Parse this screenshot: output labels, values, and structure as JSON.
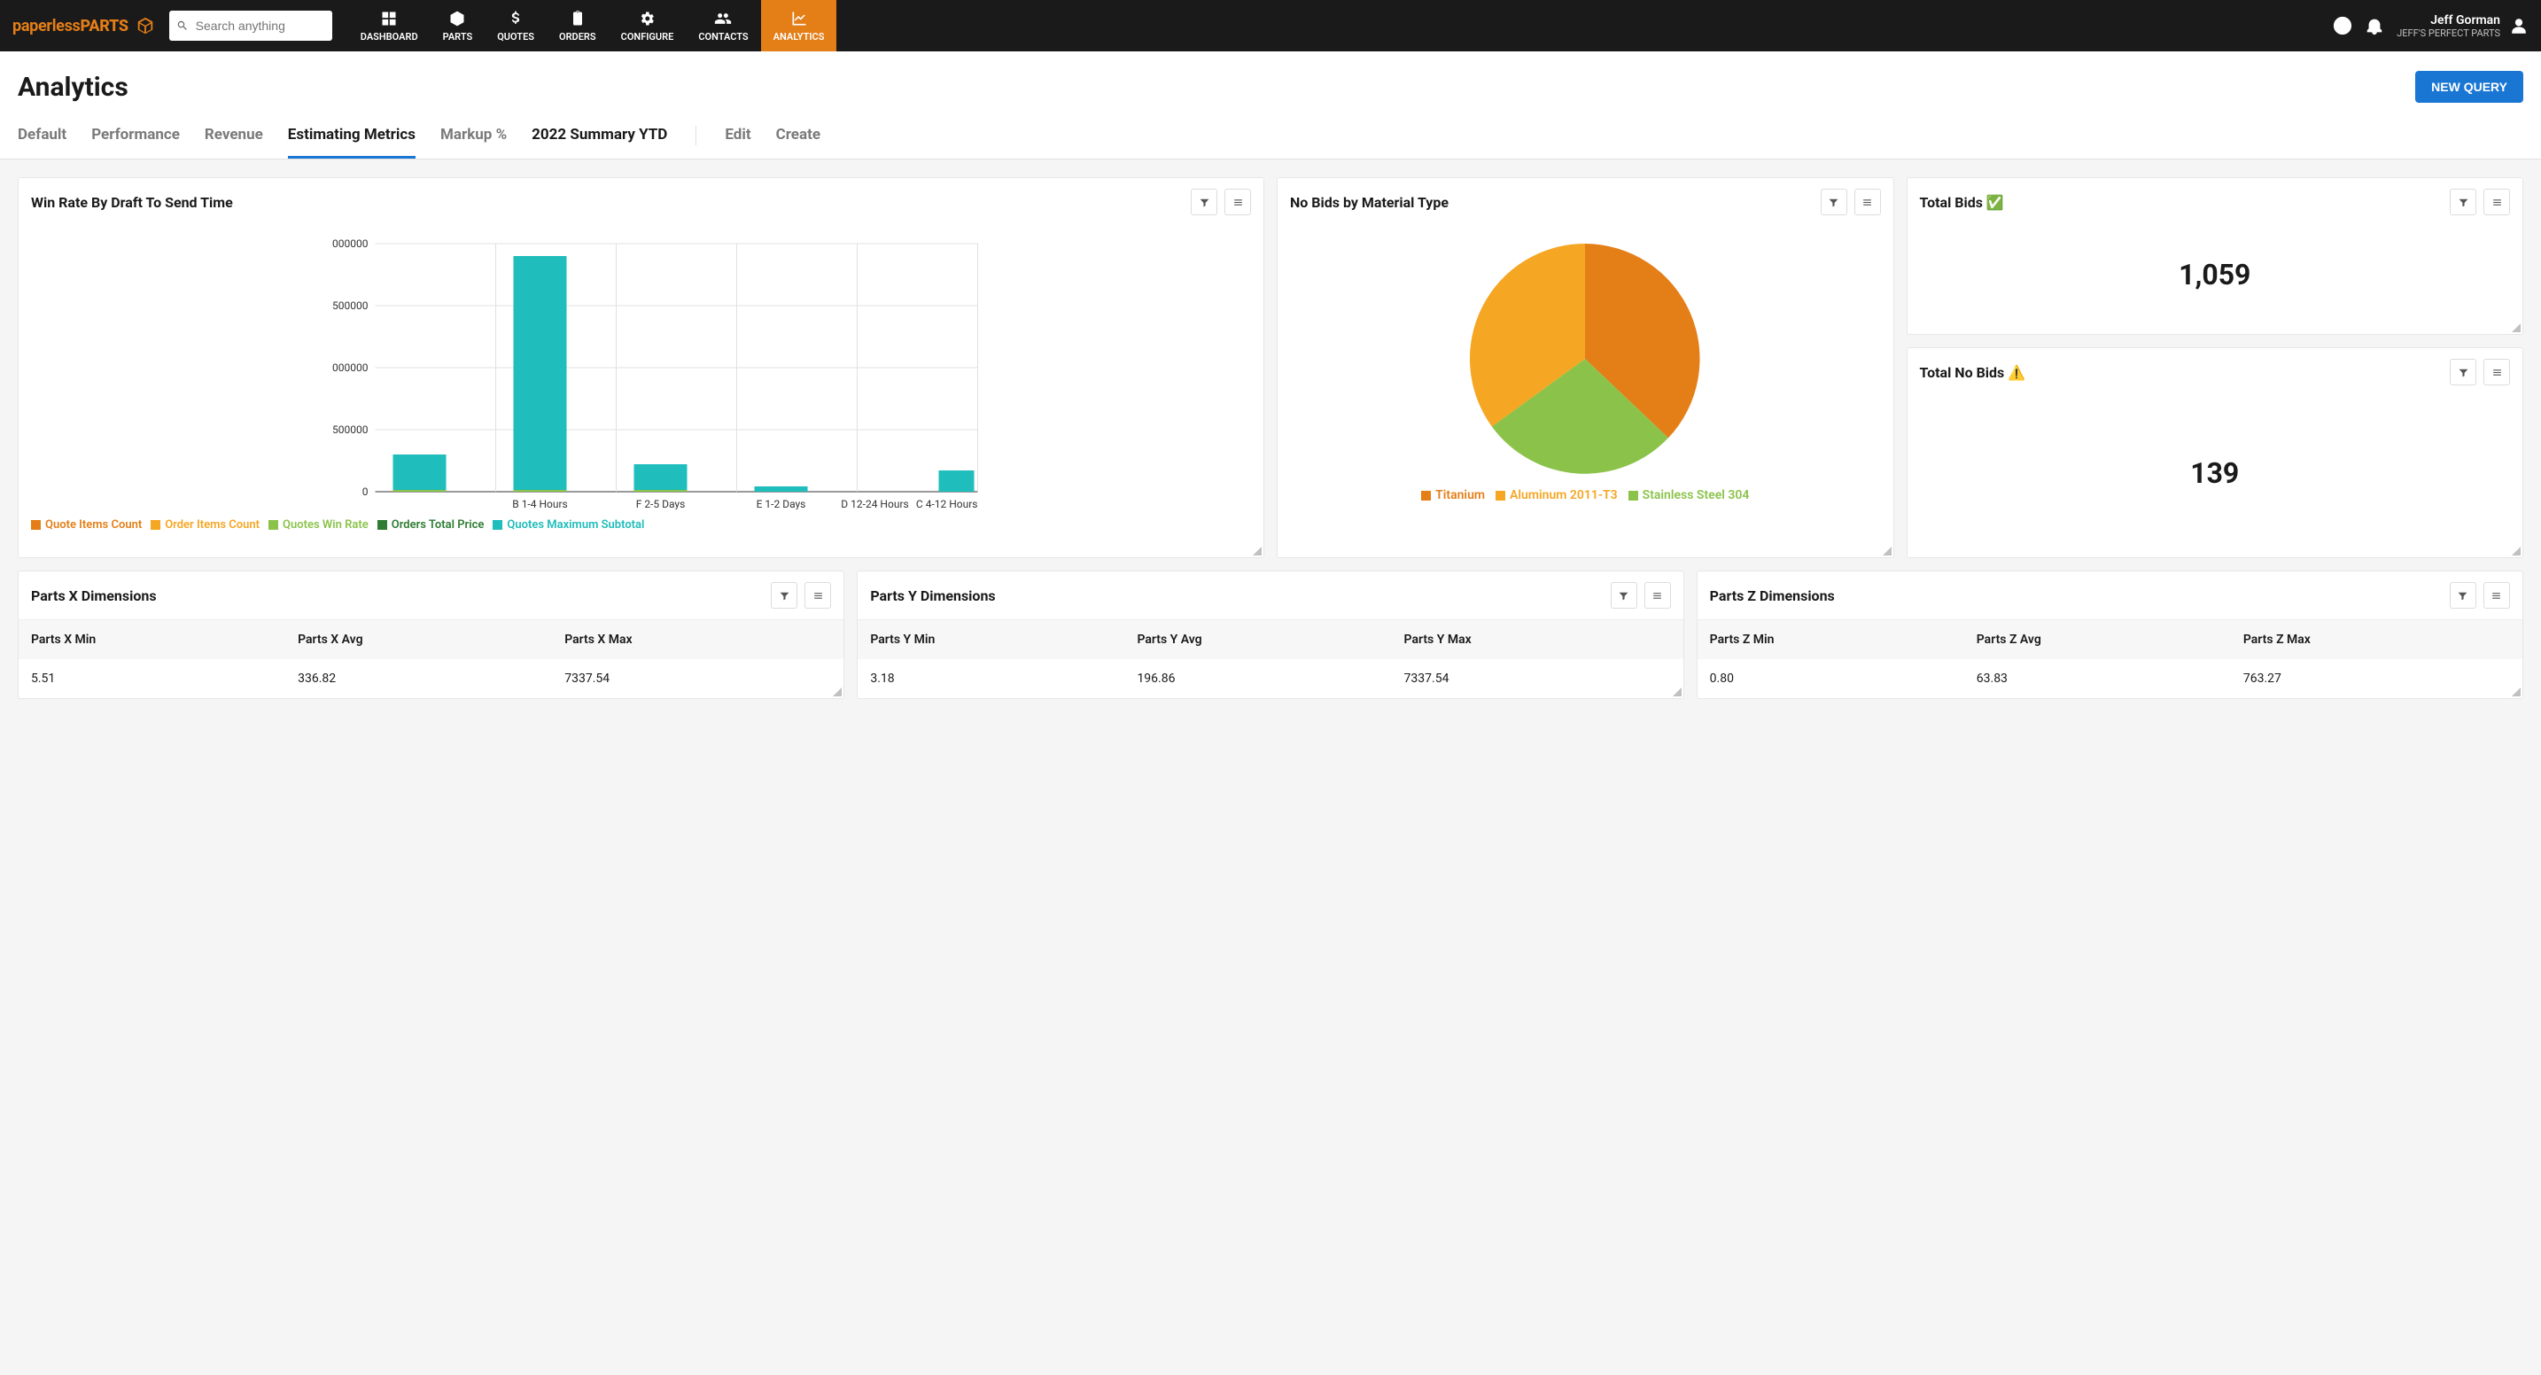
{
  "header": {
    "logo_p1": "paperless",
    "logo_p2": "PARTS",
    "search_placeholder": "Search anything",
    "nav": [
      {
        "label": "DASHBOARD"
      },
      {
        "label": "PARTS"
      },
      {
        "label": "QUOTES"
      },
      {
        "label": "ORDERS"
      },
      {
        "label": "CONFIGURE"
      },
      {
        "label": "CONTACTS"
      },
      {
        "label": "ANALYTICS"
      }
    ],
    "user_name": "Jeff Gorman",
    "user_company": "JEFF'S PERFECT PARTS"
  },
  "page": {
    "title": "Analytics",
    "new_query": "NEW QUERY",
    "tabs": [
      "Default",
      "Performance",
      "Revenue",
      "Estimating Metrics",
      "Markup %",
      "2022 Summary YTD"
    ],
    "tab_edit": "Edit",
    "tab_create": "Create"
  },
  "cards": {
    "win_rate": {
      "title": "Win Rate By Draft To Send Time",
      "legend": [
        {
          "label": "Quote Items Count",
          "color": "#e47e17"
        },
        {
          "label": "Order Items Count",
          "color": "#f0aone"
        },
        {
          "label": "Quotes Win Rate",
          "color": "#8bc34a"
        },
        {
          "label": "Orders Total Price",
          "color": "#2e7d32"
        },
        {
          "label": "Quotes Maximum Subtotal",
          "color": "#1fbdbb"
        }
      ]
    },
    "no_bids": {
      "title": "No Bids by Material Type",
      "legend": [
        {
          "label": "Titanium",
          "color": "#e47e17"
        },
        {
          "label": "Aluminum 2011-T3",
          "color": "#f5a623"
        },
        {
          "label": "Stainless Steel 304",
          "color": "#8bc34a"
        }
      ]
    },
    "total_bids": {
      "title": "Total Bids ✅",
      "value": "1,059"
    },
    "total_no_bids": {
      "title": "Total No Bids ⚠️",
      "value": "139"
    },
    "parts_x": {
      "title": "Parts X Dimensions",
      "h1": "Parts X Min",
      "h2": "Parts X Avg",
      "h3": "Parts X Max",
      "v1": "5.51",
      "v2": "336.82",
      "v3": "7337.54"
    },
    "parts_y": {
      "title": "Parts Y Dimensions",
      "h1": "Parts Y Min",
      "h2": "Parts Y Avg",
      "h3": "Parts Y Max",
      "v1": "3.18",
      "v2": "196.86",
      "v3": "7337.54"
    },
    "parts_z": {
      "title": "Parts Z Dimensions",
      "h1": "Parts Z Min",
      "h2": "Parts Z Avg",
      "h3": "Parts Z Max",
      "v1": "0.80",
      "v2": "63.83",
      "v3": "763.27"
    }
  },
  "chart_data": [
    {
      "type": "bar",
      "title": "Win Rate By Draft To Send Time",
      "xlabel": "",
      "ylabel": "",
      "ylim": [
        0,
        2000000
      ],
      "yticks": [
        "0",
        "500000",
        "000000",
        "500000",
        "000000"
      ],
      "categories": [
        "B 1-4 Hours",
        "F 2-5 Days",
        "E 1-2 Days",
        "D 12-24 Hours",
        "C 4-12 Hours"
      ],
      "series": [
        {
          "name": "Quote Items Count",
          "color": "#e47e17",
          "values": [
            10000,
            8000,
            6000,
            4000,
            5000
          ]
        },
        {
          "name": "Order Items Count",
          "color": "#f5a623",
          "values": [
            8000,
            6000,
            4000,
            3000,
            4000
          ]
        },
        {
          "name": "Quotes Win Rate",
          "color": "#8bc34a",
          "values": [
            12000,
            10000,
            7000,
            5000,
            6000
          ]
        },
        {
          "name": "Orders Total Price",
          "color": "#2e7d32",
          "values": [
            9000,
            7000,
            5000,
            3500,
            4500
          ]
        },
        {
          "name": "Quotes Maximum Subtotal",
          "color": "#1fbdbb",
          "values": [
            300000,
            1900000,
            220000,
            40000,
            170000
          ]
        }
      ]
    },
    {
      "type": "pie",
      "title": "No Bids by Material Type",
      "series": [
        {
          "name": "Titanium",
          "color": "#e47e17",
          "value": 38
        },
        {
          "name": "Aluminum 2011-T3",
          "color": "#f5a623",
          "value": 32
        },
        {
          "name": "Stainless Steel 304",
          "color": "#8bc34a",
          "value": 30
        }
      ]
    }
  ]
}
